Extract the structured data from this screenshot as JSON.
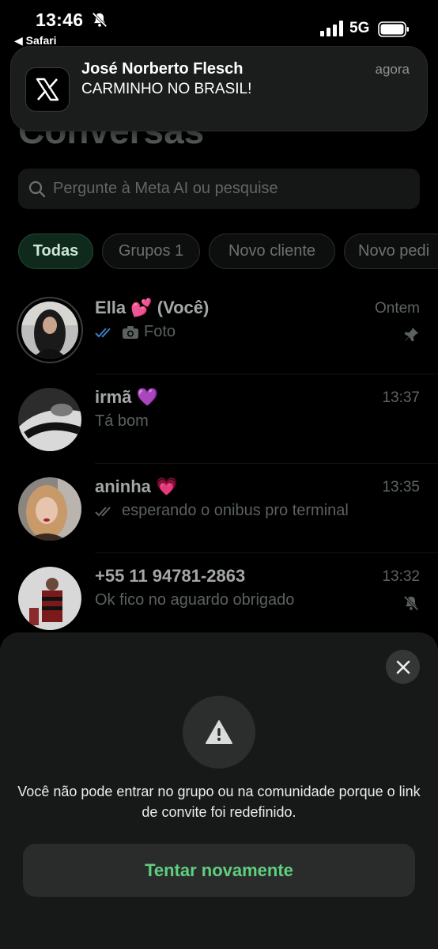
{
  "status_bar": {
    "time": "13:46",
    "back_app": "◀ Safari",
    "network": "5G",
    "icons": [
      "bell-off-icon",
      "signal-icon",
      "battery-icon"
    ]
  },
  "notification": {
    "app_icon": "x-logo-icon",
    "title": "José Norberto Flesch",
    "body": "CARMINHO NO BRASIL!",
    "time": "agora"
  },
  "page_title": "Conversas",
  "search": {
    "placeholder": "Pergunte à Meta AI ou pesquise",
    "icon": "search-icon"
  },
  "filters": [
    {
      "label": "Todas",
      "active": true
    },
    {
      "label": "Grupos 1",
      "active": false
    },
    {
      "label": "Novo cliente",
      "active": false
    },
    {
      "label": "Novo pedi",
      "active": false
    }
  ],
  "chats": [
    {
      "name": "Ella 💕 (Você)",
      "time": "Ontem",
      "preview": "Foto",
      "read_ticks": "blue",
      "preview_icon": "camera-icon",
      "side_icon": "pin-icon"
    },
    {
      "name": "irmã 💜",
      "time": "13:37",
      "preview": "Tá bom"
    },
    {
      "name": "aninha 💗",
      "time": "13:35",
      "preview": "esperando o onibus pro terminal",
      "read_ticks": "grey"
    },
    {
      "name": "+55 11 94781-2863",
      "time": "13:32",
      "preview": "Ok fico no aguardo obrigado",
      "side_icon": "bell-off-icon"
    }
  ],
  "sheet": {
    "icon": "warning-icon",
    "message": "Você não pode entrar no grupo ou na comunidade porque o link de convite foi redefinido.",
    "retry_label": "Tentar novamente",
    "close_icon": "close-icon"
  },
  "colors": {
    "accent_green": "#5fcf7f",
    "blue_ticks": "#53bdeb",
    "background": "#000000",
    "sheet": "#171818"
  }
}
